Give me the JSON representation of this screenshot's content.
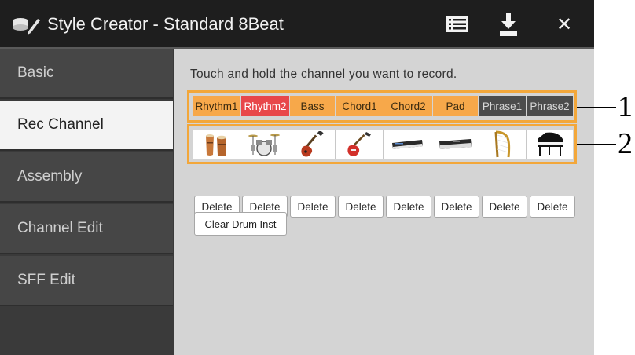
{
  "window": {
    "title": "Style Creator - Standard 8Beat",
    "icons": [
      "style-creator-icon",
      "menu-list-icon",
      "save-download-icon",
      "close-icon"
    ],
    "close_glyph": "✕"
  },
  "sidebar": {
    "items": [
      {
        "label": "Basic",
        "active": false
      },
      {
        "label": "Rec Channel",
        "active": true
      },
      {
        "label": "Assembly",
        "active": false
      },
      {
        "label": "Channel Edit",
        "active": false
      },
      {
        "label": "SFF Edit",
        "active": false
      }
    ]
  },
  "main": {
    "instruction": "Touch and hold the channel you want to record.",
    "channels": [
      {
        "label": "Rhythm1",
        "state": "normal"
      },
      {
        "label": "Rhythm2",
        "state": "recording"
      },
      {
        "label": "Bass",
        "state": "normal"
      },
      {
        "label": "Chord1",
        "state": "normal"
      },
      {
        "label": "Chord2",
        "state": "normal"
      },
      {
        "label": "Pad",
        "state": "normal"
      },
      {
        "label": "Phrase1",
        "state": "disabled"
      },
      {
        "label": "Phrase2",
        "state": "disabled"
      }
    ],
    "instruments": [
      "conga-icon",
      "drum-kit-icon",
      "electric-bass-icon",
      "electric-guitar-icon",
      "synth-keyboard-icon",
      "keyboard-icon",
      "harp-icon",
      "grand-piano-icon"
    ],
    "delete_label": "Delete",
    "clear_drum_label": "Clear Drum Inst"
  },
  "callouts": {
    "one": "1",
    "two": "2"
  },
  "colors": {
    "channel_orange": "#f7a84a",
    "channel_red": "#e8474a",
    "channel_disabled": "#4c4c4c",
    "highlight_frame": "#f3a73a"
  }
}
